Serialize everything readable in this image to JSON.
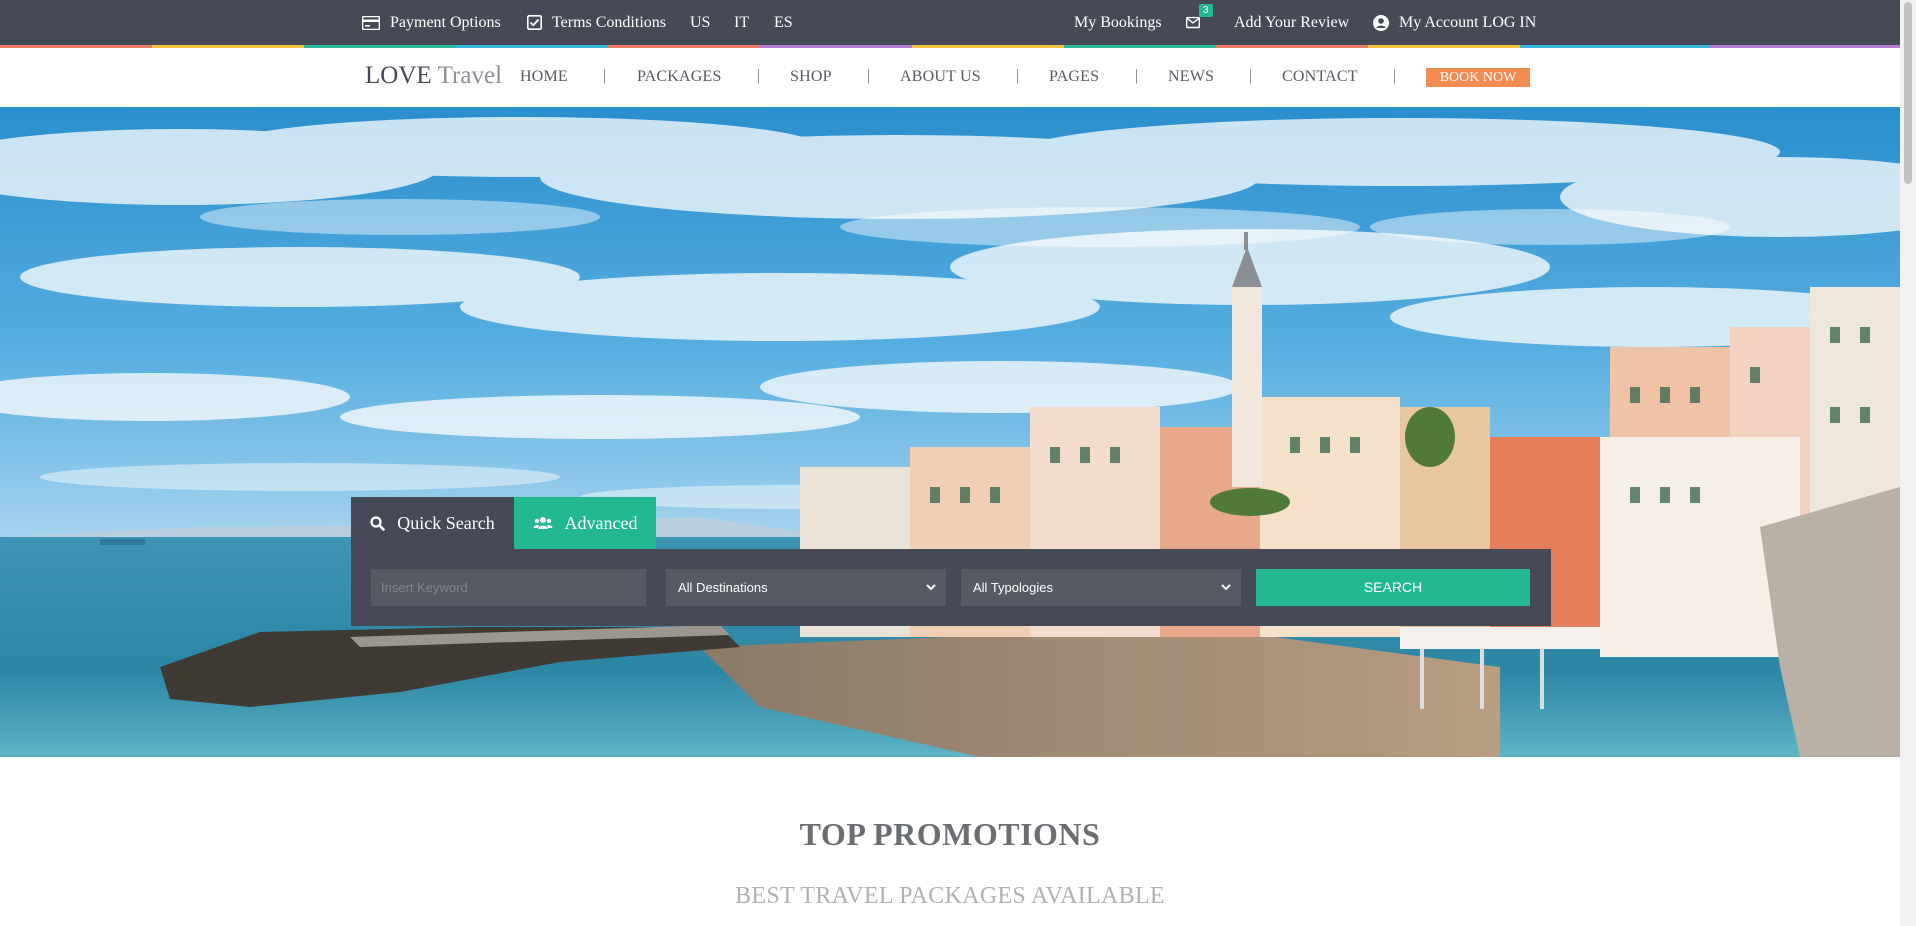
{
  "topbar": {
    "payment_options": "Payment Options",
    "terms_conditions": "Terms Conditions",
    "languages": [
      "US",
      "IT",
      "ES"
    ],
    "my_bookings": "My Bookings",
    "mail_badge": "3",
    "add_review": "Add Your Review",
    "my_account": "My Account LOG IN"
  },
  "nav": {
    "logo_primary": "LOVE",
    "logo_secondary": "Travel",
    "items": [
      "HOME",
      "PACKAGES",
      "SHOP",
      "ABOUT US",
      "PAGES",
      "NEWS",
      "CONTACT"
    ],
    "separator": "|",
    "book_now": "BOOK NOW"
  },
  "search": {
    "tab_quick": "Quick Search",
    "tab_advanced": "Advanced",
    "keyword_placeholder": "Insert Keyword",
    "destinations_selected": "All Destinations",
    "typologies_selected": "All Typologies",
    "search_button": "SEARCH"
  },
  "promotions": {
    "title": "TOP PROMOTIONS",
    "subtitle": "BEST TRAVEL PACKAGES AVAILABLE"
  },
  "colors": {
    "dark": "#454a56",
    "accent_green": "#21b892",
    "accent_orange": "#f28c53"
  },
  "icons": {
    "payment": "credit-card-icon",
    "terms": "checkbox-icon",
    "mail": "envelope-icon",
    "account": "user-circle-icon",
    "quick_search": "search-icon",
    "advanced": "users-icon",
    "select": "chevron-down-icon"
  }
}
